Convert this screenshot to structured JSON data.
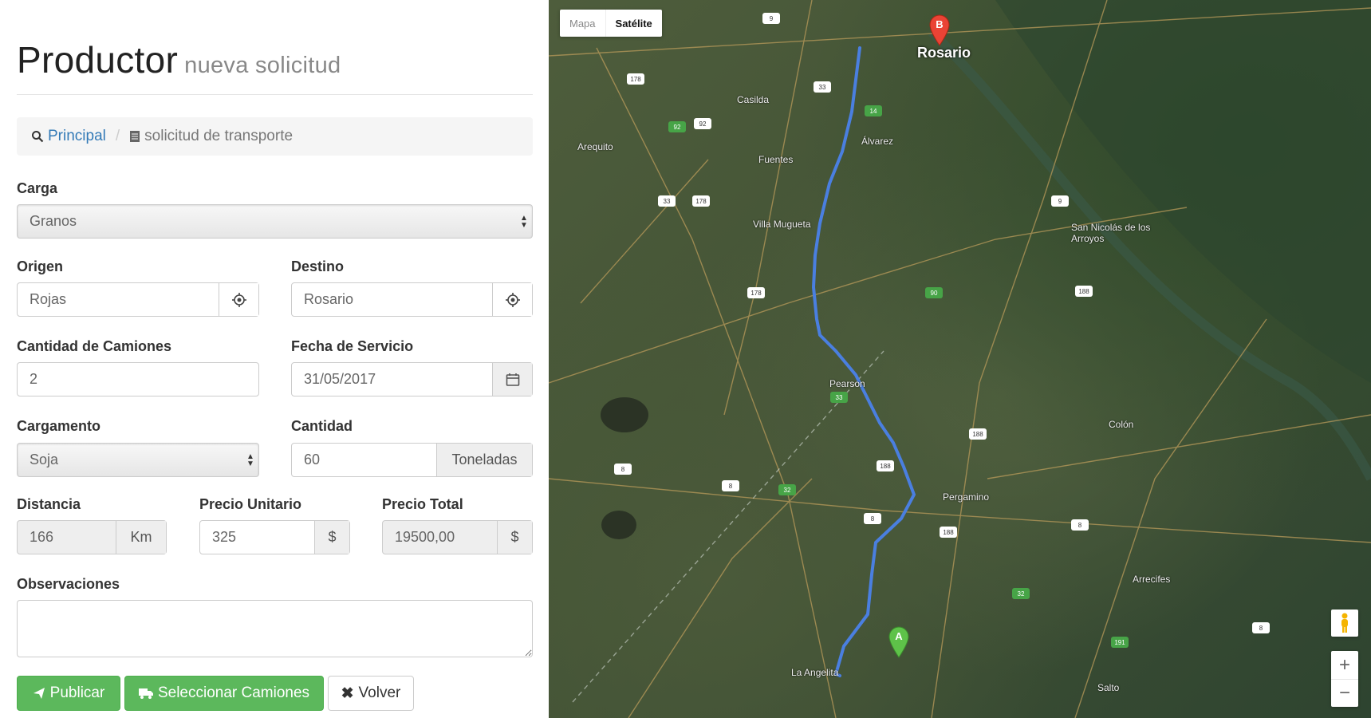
{
  "header": {
    "title": "Productor",
    "subtitle": "nueva solicitud"
  },
  "breadcrumb": {
    "home": "Principal",
    "current": "solicitud de transporte"
  },
  "form": {
    "carga": {
      "label": "Carga",
      "value": "Granos"
    },
    "origen": {
      "label": "Origen",
      "value": "Rojas"
    },
    "destino": {
      "label": "Destino",
      "value": "Rosario"
    },
    "camiones": {
      "label": "Cantidad de Camiones",
      "value": "2"
    },
    "fecha": {
      "label": "Fecha de Servicio",
      "value": "31/05/2017"
    },
    "cargamento": {
      "label": "Cargamento",
      "value": "Soja"
    },
    "cantidad": {
      "label": "Cantidad",
      "value": "60",
      "unit": "Toneladas"
    },
    "distancia": {
      "label": "Distancia",
      "value": "166",
      "unit": "Km"
    },
    "precio_unitario": {
      "label": "Precio Unitario",
      "value": "325",
      "unit": "$"
    },
    "precio_total": {
      "label": "Precio Total",
      "value": "19500,00",
      "unit": "$"
    },
    "observaciones": {
      "label": "Observaciones",
      "value": ""
    }
  },
  "buttons": {
    "publicar": "Publicar",
    "seleccionar": "Seleccionar Camiones",
    "volver": "Volver"
  },
  "map": {
    "type_map": "Mapa",
    "type_sat": "Satélite",
    "marker_a": "A",
    "marker_b": "B",
    "zoom_in": "+",
    "zoom_out": "−",
    "route_color": "#4a7fe0",
    "cities": {
      "rosario": "Rosario",
      "pergamino": "Pergamino",
      "san_nicolas": "San Nicolás de los Arroyos",
      "pearson": "Pearson",
      "villa_mugueta": "Villa Mugueta",
      "arequito": "Arequito",
      "la_angelita": "La Angelita",
      "salto": "Salto",
      "arrecifes": "Arrecifes",
      "colon": "Colón",
      "casilda": "Casilda",
      "alvarez": "Álvarez",
      "fuentes": "Fuentes"
    }
  }
}
